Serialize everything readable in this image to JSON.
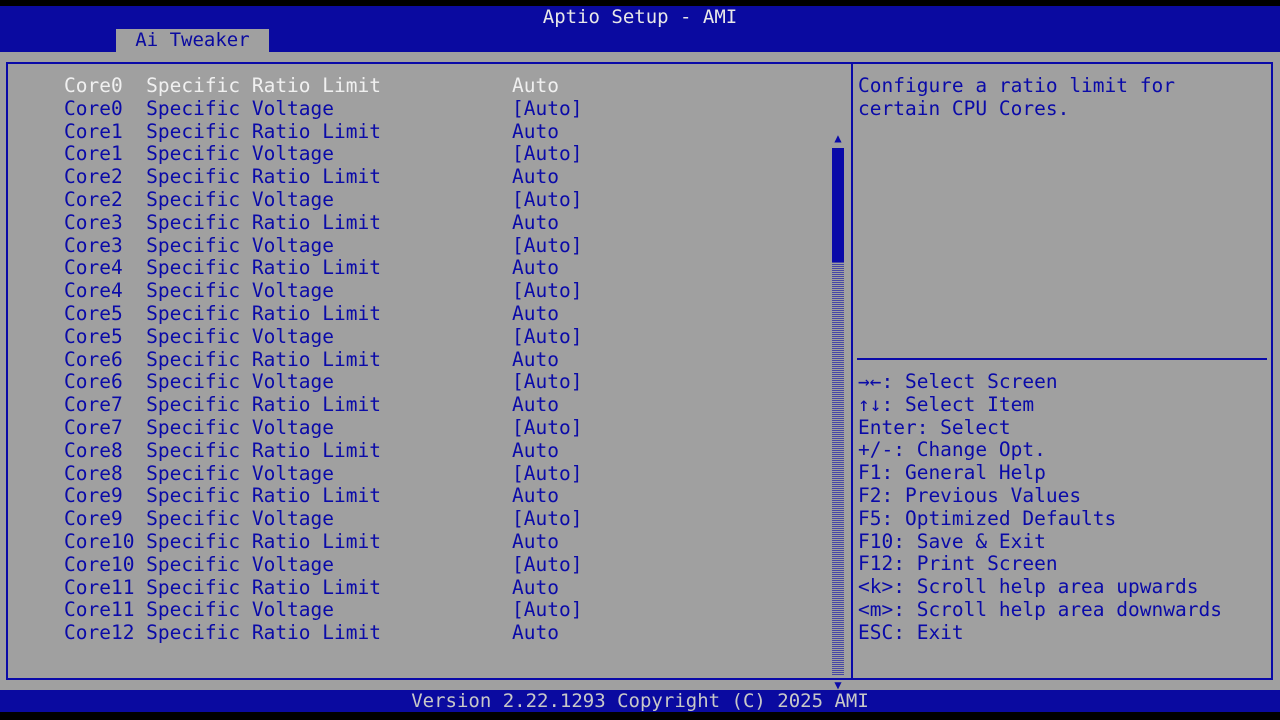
{
  "header": {
    "title": "Aptio Setup - AMI",
    "tab": "Ai Tweaker"
  },
  "items": [
    {
      "label": "Core0  Specific Ratio Limit",
      "value": "Auto"
    },
    {
      "label": "Core0  Specific Voltage",
      "value": "[Auto]"
    },
    {
      "label": "Core1  Specific Ratio Limit",
      "value": "Auto"
    },
    {
      "label": "Core1  Specific Voltage",
      "value": "[Auto]"
    },
    {
      "label": "Core2  Specific Ratio Limit",
      "value": "Auto"
    },
    {
      "label": "Core2  Specific Voltage",
      "value": "[Auto]"
    },
    {
      "label": "Core3  Specific Ratio Limit",
      "value": "Auto"
    },
    {
      "label": "Core3  Specific Voltage",
      "value": "[Auto]"
    },
    {
      "label": "Core4  Specific Ratio Limit",
      "value": "Auto"
    },
    {
      "label": "Core4  Specific Voltage",
      "value": "[Auto]"
    },
    {
      "label": "Core5  Specific Ratio Limit",
      "value": "Auto"
    },
    {
      "label": "Core5  Specific Voltage",
      "value": "[Auto]"
    },
    {
      "label": "Core6  Specific Ratio Limit",
      "value": "Auto"
    },
    {
      "label": "Core6  Specific Voltage",
      "value": "[Auto]"
    },
    {
      "label": "Core7  Specific Ratio Limit",
      "value": "Auto"
    },
    {
      "label": "Core7  Specific Voltage",
      "value": "[Auto]"
    },
    {
      "label": "Core8  Specific Ratio Limit",
      "value": "Auto"
    },
    {
      "label": "Core8  Specific Voltage",
      "value": "[Auto]"
    },
    {
      "label": "Core9  Specific Ratio Limit",
      "value": "Auto"
    },
    {
      "label": "Core9  Specific Voltage",
      "value": "[Auto]"
    },
    {
      "label": "Core10 Specific Ratio Limit",
      "value": "Auto"
    },
    {
      "label": "Core10 Specific Voltage",
      "value": "[Auto]"
    },
    {
      "label": "Core11 Specific Ratio Limit",
      "value": "Auto"
    },
    {
      "label": "Core11 Specific Voltage",
      "value": "[Auto]"
    },
    {
      "label": "Core12 Specific Ratio Limit",
      "value": "Auto"
    }
  ],
  "help": {
    "lines": [
      "Configure a ratio limit for",
      "certain CPU Cores."
    ]
  },
  "keys": [
    "→←: Select Screen",
    "↑↓: Select Item",
    "Enter: Select",
    "+/-: Change Opt.",
    "F1: General Help",
    "F2: Previous Values",
    "F5: Optimized Defaults",
    "F10: Save & Exit",
    "F12: Print Screen",
    "<k>: Scroll help area upwards",
    "<m>: Scroll help area downwards",
    "ESC: Exit"
  ],
  "scrollbar": {
    "up_icon": "▲",
    "down_icon": "▼"
  },
  "footer": "Version 2.22.1293 Copyright (C) 2025 AMI"
}
